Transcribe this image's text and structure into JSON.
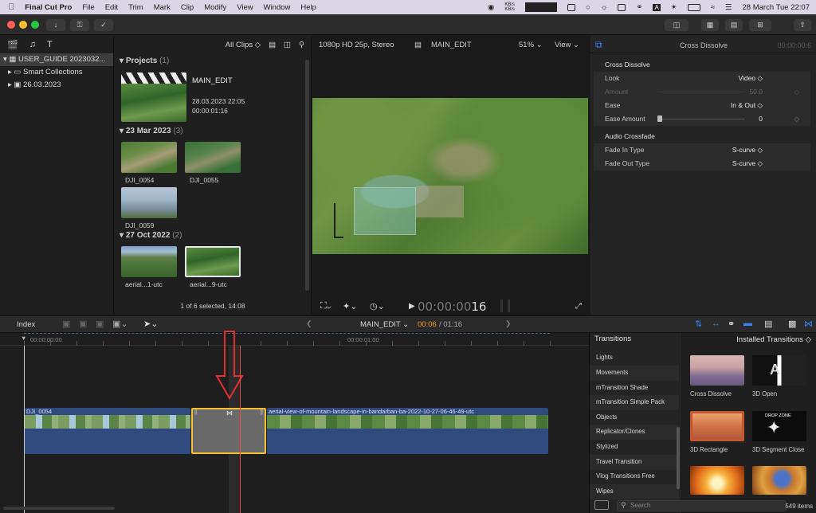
{
  "menubar": {
    "app_name": "Final Cut Pro",
    "items": [
      "File",
      "Edit",
      "Trim",
      "Mark",
      "Clip",
      "Modify",
      "View",
      "Window",
      "Help"
    ],
    "network": "KB/s\nKB/s",
    "date_time": "28 March Tue  22:07"
  },
  "library": {
    "items": [
      {
        "label": "USER_GUIDE 2023032...",
        "icon": "library-icon",
        "selected": true
      },
      {
        "label": "Smart Collections",
        "icon": "folder-icon",
        "selected": false
      },
      {
        "label": "26.03.2023",
        "icon": "event-icon",
        "selected": false
      }
    ]
  },
  "browser": {
    "filter": "All Clips ◇",
    "groups": [
      {
        "title": "Projects",
        "count": "(1)"
      },
      {
        "title": "23 Mar 2023",
        "count": "(3)"
      },
      {
        "title": "27 Oct 2022",
        "count": "(2)"
      }
    ],
    "project": {
      "name": "MAIN_EDIT",
      "date": "28.03.2023 22:05",
      "duration": "00:00:01:16"
    },
    "clips": [
      "DJI_0054",
      "DJI_0055",
      "DJI_0059",
      "aerial...1-utc",
      "aerial...9-utc"
    ],
    "footer": "1 of 6 selected, 14:08"
  },
  "viewer": {
    "format": "1080p HD 25p, Stereo",
    "project": "MAIN_EDIT",
    "zoom": "51% ⌄",
    "view": "View ⌄",
    "timecode": "00:00:00",
    "timecode_frames": "16"
  },
  "inspector": {
    "title": "Cross Dissolve",
    "duration": "00:00:00:6",
    "section1": "Cross Dissolve",
    "look_label": "Look",
    "look_value": "Video ◇",
    "amount_label": "Amount",
    "amount_value": "50.0",
    "ease_label": "Ease",
    "ease_value": "In & Out ◇",
    "ease_amount_label": "Ease Amount",
    "ease_amount_value": "0",
    "section2": "Audio Crossfade",
    "fade_in_label": "Fade In Type",
    "fade_in_value": "S-curve ◇",
    "fade_out_label": "Fade Out Type",
    "fade_out_value": "S-curve ◇"
  },
  "timeline": {
    "index_label": "Index",
    "project": "MAIN_EDIT ⌄",
    "position": "00:06",
    "duration": "/ 01:16",
    "ruler_start": "00:00:00:00",
    "ruler_mid": "00:00:01:00",
    "clip1_name": "DJI_0054",
    "clip2_name": "aerial-view-of-mountain-landscape-in-bandarban-ba-2022-10-27-06-46-49-utc"
  },
  "transitions": {
    "title": "Transitions",
    "installed": "Installed Transitions ◇",
    "categories": [
      "Lights",
      "Movements",
      "mTransition Shade",
      "mTransition Simple Pack",
      "Objects",
      "Replicator/Clones",
      "Stylized",
      "Travel Transition",
      "Vlog Transitions Free",
      "Wipes"
    ],
    "items": [
      "Cross Dissolve",
      "3D Open",
      "3D Rectangle",
      "3D Segment Close"
    ],
    "search_placeholder": "Search",
    "count": "549 items",
    "thumb_text_open": "A",
    "thumb_text_segment": "DROP ZONE"
  },
  "colors": {
    "accent": "#3b82f6",
    "playhead": "#e74c3c",
    "selected_transition": "#f2c230",
    "audio": "#2f4a7d"
  }
}
